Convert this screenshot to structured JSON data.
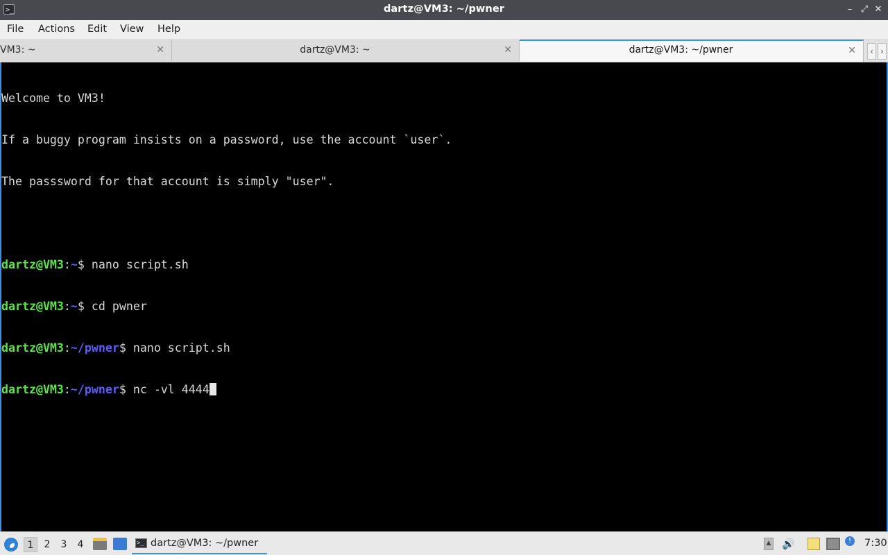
{
  "window": {
    "title": "dartz@VM3: ~/pwner",
    "icon": "terminal-icon",
    "minimize_icon": "minimize-icon",
    "maximize_icon": "maximize-icon",
    "close_icon": "close-icon"
  },
  "menu": {
    "items": [
      "File",
      "Actions",
      "Edit",
      "View",
      "Help"
    ]
  },
  "tabs": [
    {
      "label": "VM3: ~",
      "active": false
    },
    {
      "label": "dartz@VM3: ~",
      "active": false
    },
    {
      "label": "dartz@VM3: ~/pwner",
      "active": true
    }
  ],
  "terminal": {
    "motd": [
      "Welcome to VM3!",
      "If a buggy program insists on a password, use the account `user`.",
      "The passsword for that account is simply \"user\"."
    ],
    "commands": [
      {
        "user": "dartz@VM3",
        "path": "~",
        "cmd": "nano script.sh"
      },
      {
        "user": "dartz@VM3",
        "path": "~",
        "cmd": "cd pwner"
      },
      {
        "user": "dartz@VM3",
        "path": "~/pwner",
        "cmd": "nano script.sh"
      },
      {
        "user": "dartz@VM3",
        "path": "~/pwner",
        "cmd": "nc -vl 4444"
      }
    ]
  },
  "taskbar": {
    "workspaces": [
      "1",
      "2",
      "3",
      "4"
    ],
    "active_workspace": "1",
    "task_label": "dartz@VM3: ~/pwner",
    "clock": "7:30",
    "colors": {
      "accent": "#3d8ee6",
      "prompt_user": "#5ee44a",
      "prompt_path": "#5c5cff"
    }
  }
}
